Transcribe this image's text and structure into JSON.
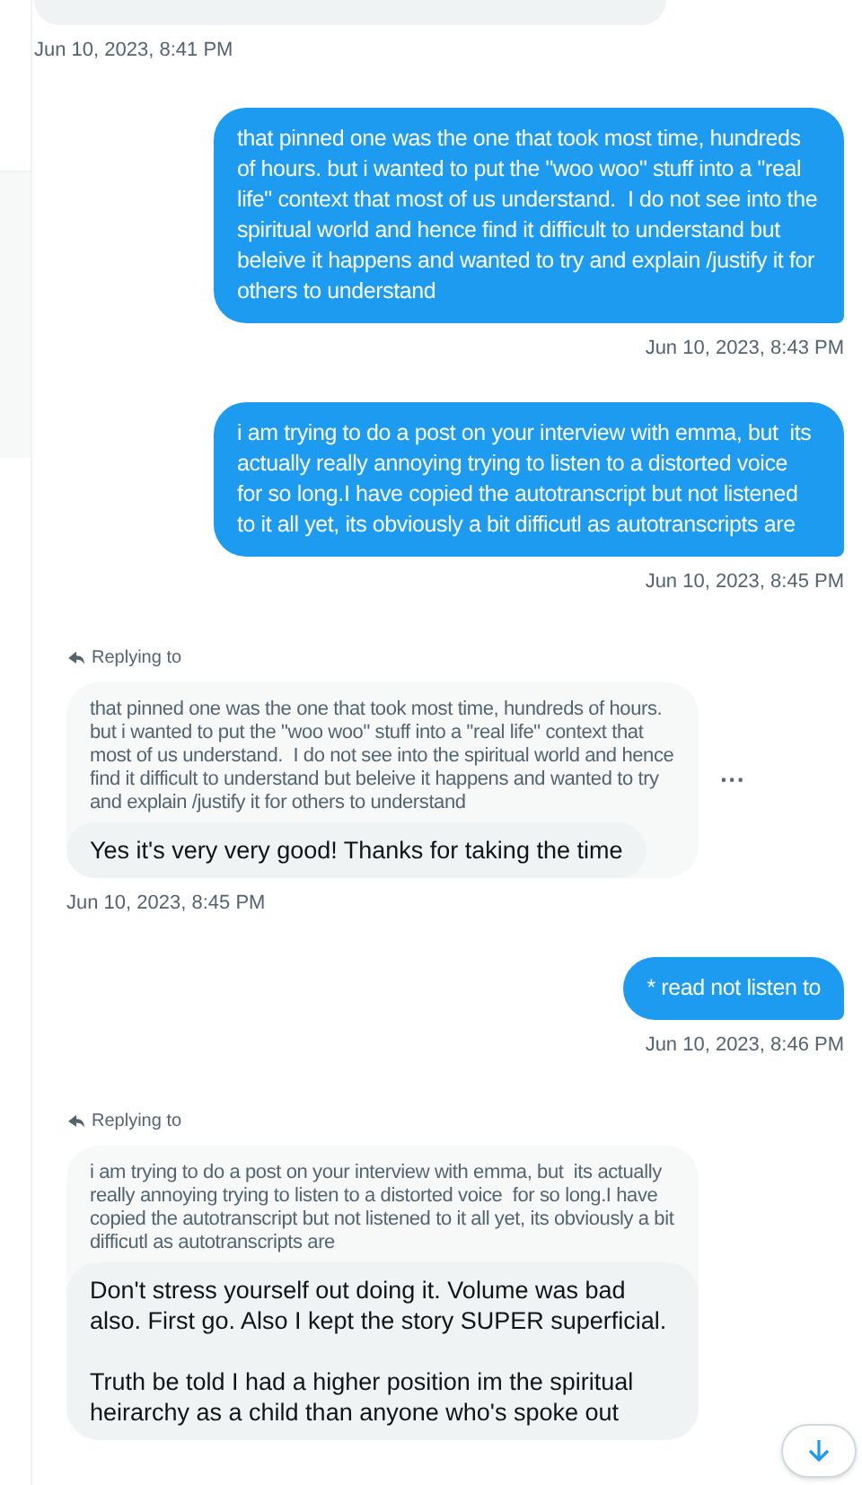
{
  "messages": [
    {
      "kind": "received",
      "time": "Jun 10, 2023, 8:41 PM"
    },
    {
      "kind": "sent",
      "text": "that pinned one was the one that took most time, hundreds of hours. but i wanted to put the \"woo woo\" stuff into a \"real life\" context that most of us understand.  I do not see into the spiritual world and hence find it difficult to understand but beleive it happens and wanted to try and explain /justify it for others to understand",
      "time": "Jun 10, 2023, 8:43 PM"
    },
    {
      "kind": "sent",
      "text": "i am trying to do a post on your interview with emma, but  its actually really annoying trying to listen to a distorted voice  for so long.I have copied the autotranscript but not listened to it all yet, its obviously a bit difficutl as autotranscripts are",
      "time": "Jun 10, 2023, 8:45 PM"
    },
    {
      "kind": "reply",
      "replying_label": "Replying to",
      "quoted": "that pinned one was the one that took most time, hundreds of hours. but i wanted to put the \"woo woo\" stuff into a \"real life\" context that most of us understand.  I do not see into the spiritual world and hence find it difficult to understand but beleive it happens and wanted to try and explain /justify it for others to understand",
      "text": "Yes it's very very good! Thanks for taking the time",
      "time": "Jun 10, 2023, 8:45 PM",
      "more": "···"
    },
    {
      "kind": "sent",
      "text": "* read not listen to",
      "time": "Jun 10, 2023, 8:46 PM"
    },
    {
      "kind": "reply",
      "replying_label": "Replying to",
      "quoted": "i am trying to do a post on your interview with emma, but  its actually really annoying trying to listen to a distorted voice  for so long.I have copied the autotranscript but not listened to it all yet, its obviously a bit difficutl as autotranscripts are",
      "text": "Don't stress yourself out doing it. Volume was bad also. First go. Also I kept the story SUPER superficial.\n\nTruth be told I had a higher position im the spiritual heirarchy as a child than anyone who's spoke out"
    }
  ]
}
